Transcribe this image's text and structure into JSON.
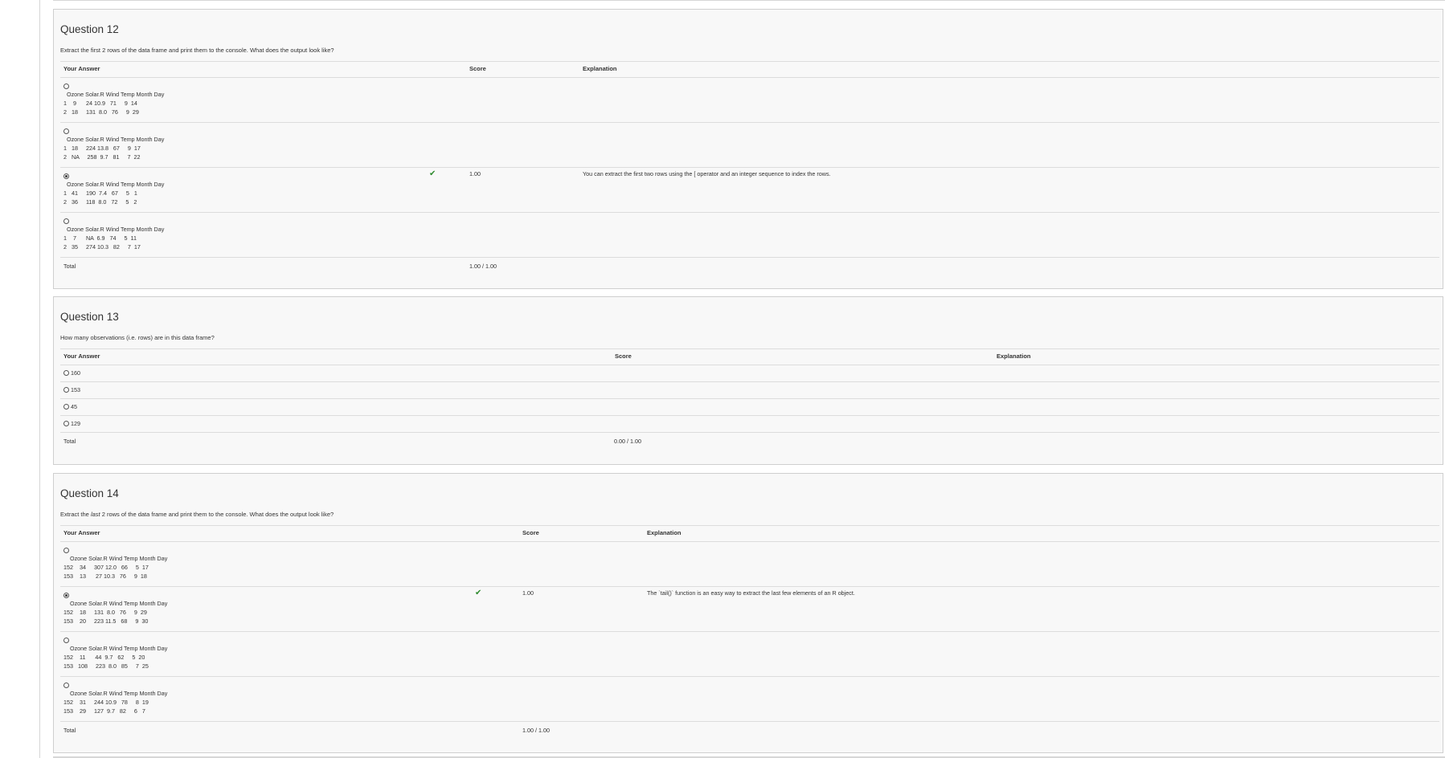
{
  "questions": [
    {
      "title": "Question 12",
      "prompt": "Extract the first 2 rows of the data frame and print them to the console. What does the output look like?",
      "headers": {
        "answer": "Your Answer",
        "score": "Score",
        "explanation": "Explanation"
      },
      "options": [
        {
          "header": "  Ozone Solar.R Wind Temp Month Day",
          "row1": "1    9      24 10.9   71     9  14",
          "row2": "2   18     131  8.0   76     9  29",
          "selected": false,
          "score": "",
          "explanation": ""
        },
        {
          "header": "  Ozone Solar.R Wind Temp Month Day",
          "row1": "1   18     224 13.8   67     9  17",
          "row2": "2   NA     258  9.7   81     7  22",
          "selected": false,
          "score": "",
          "explanation": ""
        },
        {
          "header": "  Ozone Solar.R Wind Temp Month Day",
          "row1": "1   41     190  7.4   67     5   1",
          "row2": "2   36     118  8.0   72     5   2",
          "selected": true,
          "correct": true,
          "score": "1.00",
          "explanation": "You can extract the first two rows using the [ operator and an integer sequence to index the rows."
        },
        {
          "header": "  Ozone Solar.R Wind Temp Month Day",
          "row1": "1    7      NA  6.9   74     5  11",
          "row2": "2   35     274 10.3   82     7  17",
          "selected": false,
          "score": "",
          "explanation": ""
        }
      ],
      "total_label": "Total",
      "total_value": "1.00 / 1.00"
    },
    {
      "title": "Question 13",
      "prompt": "How many observations (i.e. rows) are in this data frame?",
      "headers": {
        "answer": "Your Answer",
        "score": "Score",
        "explanation": "Explanation"
      },
      "options": [
        {
          "label": "160",
          "selected": false
        },
        {
          "label": "153",
          "selected": false
        },
        {
          "label": "45",
          "selected": false
        },
        {
          "label": "129",
          "selected": false
        }
      ],
      "total_label": "Total",
      "total_value": "0.00 / 1.00"
    },
    {
      "title": "Question 14",
      "prompt_pre": "Extract the ",
      "prompt_em": "last",
      "prompt_post": " 2 rows of the data frame and print them to the console. What does the output look like?",
      "headers": {
        "answer": "Your Answer",
        "score": "Score",
        "explanation": "Explanation"
      },
      "options": [
        {
          "header": "    Ozone Solar.R Wind Temp Month Day",
          "row1": "152    34     307 12.0   66     5  17",
          "row2": "153    13      27 10.3   76     9  18",
          "selected": false,
          "score": "",
          "explanation": ""
        },
        {
          "header": "    Ozone Solar.R Wind Temp Month Day",
          "row1": "152    18     131  8.0   76     9  29",
          "row2": "153    20     223 11.5   68     9  30",
          "selected": true,
          "correct": true,
          "score": "1.00",
          "explanation": "The `tail()` function is an easy way to extract the last few elements of an R object."
        },
        {
          "header": "    Ozone Solar.R Wind Temp Month Day",
          "row1": "152    11      44  9.7   62     5  20",
          "row2": "153   108     223  8.0   85     7  25",
          "selected": false,
          "score": "",
          "explanation": ""
        },
        {
          "header": "    Ozone Solar.R Wind Temp Month Day",
          "row1": "152    31     244 10.9   78     8  19",
          "row2": "153    29     127  9.7   82     6   7",
          "selected": false,
          "score": "",
          "explanation": ""
        }
      ],
      "total_label": "Total",
      "total_value": "1.00 / 1.00"
    }
  ],
  "colors": {
    "check": "#2e8b2e",
    "panel": "#f8f8f8",
    "border": "#cfcfcf"
  }
}
